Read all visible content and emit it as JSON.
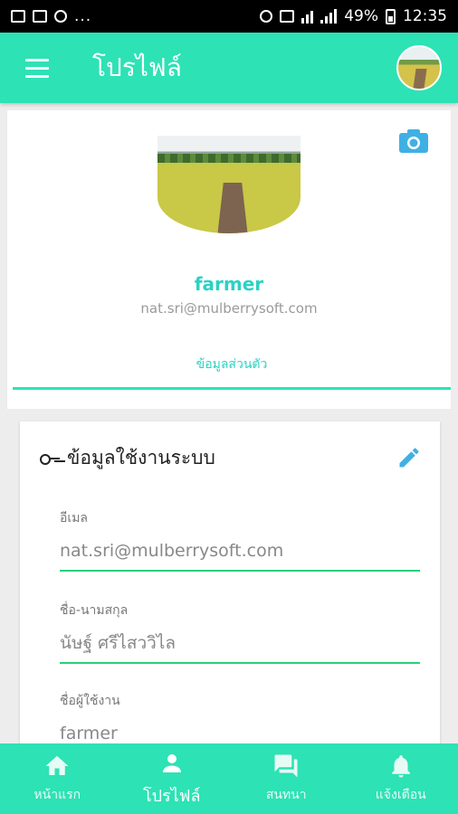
{
  "status_bar": {
    "left_ellipsis": "...",
    "battery": "49%",
    "time": "12:35"
  },
  "app_bar": {
    "title": "โปรไฟล์",
    "menu_icon": "hamburger-menu-icon",
    "avatar_icon": "user-avatar"
  },
  "profile": {
    "username": "farmer",
    "email": "nat.sri@mulberrysoft.com",
    "tab_label": "ข้อมูลส่วนตัว",
    "camera_icon": "camera-icon"
  },
  "system_info": {
    "title": "ข้อมูลใช้งานระบบ",
    "header_icon": "key-icon",
    "edit_icon": "pencil-icon",
    "fields": [
      {
        "label": "อีเมล",
        "value": "nat.sri@mulberrysoft.com"
      },
      {
        "label": "ชื่อ-นามสกุล",
        "value": "นัษฐ์ ศรีไสววิไล"
      },
      {
        "label": "ชื่อผู้ใช้งาน",
        "value": "farmer"
      }
    ]
  },
  "bottom_nav": {
    "items": [
      {
        "label": "หน้าแรก",
        "icon": "home-icon",
        "active": false
      },
      {
        "label": "โปรไฟล์",
        "icon": "person-icon",
        "active": true
      },
      {
        "label": "สนทนา",
        "icon": "chat-icon",
        "active": false
      },
      {
        "label": "แจ้งเตือน",
        "icon": "bell-icon",
        "active": false
      }
    ]
  },
  "colors": {
    "primary": "#2de2b5",
    "accent_text": "#2bd2c3",
    "field_underline": "#29d07a",
    "icon_blue": "#3fb0e3"
  }
}
